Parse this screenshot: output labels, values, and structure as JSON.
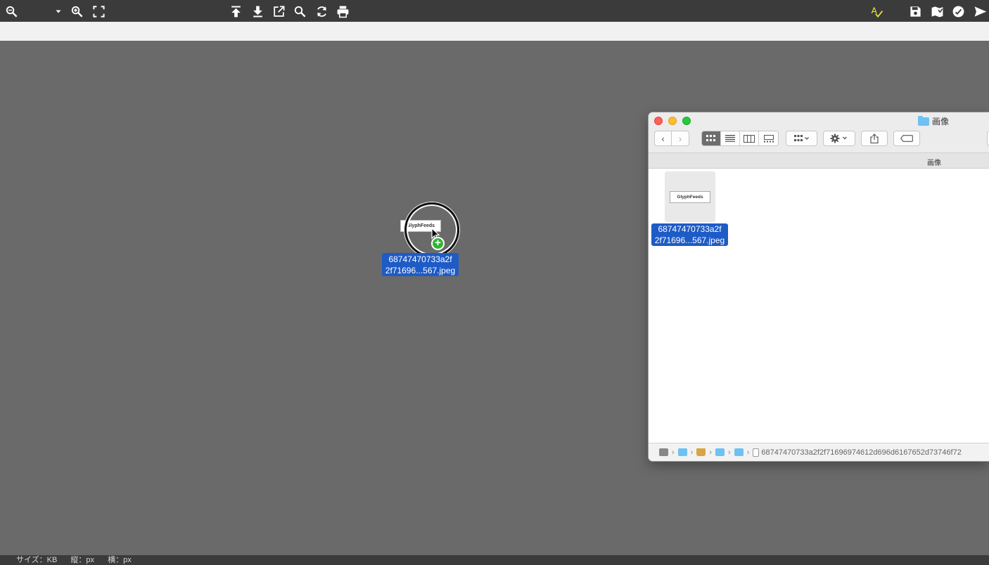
{
  "toolbar": {
    "left_icons": [
      "zoom-out-icon",
      "dropdown-arrow-icon",
      "zoom-in-icon",
      "fullscreen-icon"
    ],
    "center_icons": [
      "upload-icon",
      "download-icon",
      "open-external-icon",
      "search-icon",
      "refresh-icon",
      "print-icon"
    ],
    "right_icons": [
      "spellcheck-icon",
      "save-icon",
      "map-icon",
      "check-circle-icon",
      "send-icon"
    ],
    "spellcheck_label": "A"
  },
  "drag": {
    "thumb_text": "GlyphFeeds",
    "label_line1": "68747470733a2f",
    "label_line2": "2f71696...567.jpeg",
    "plus": "+"
  },
  "finder": {
    "title": "画像",
    "path_header": "画像",
    "back": "‹",
    "forward": "›",
    "file": {
      "thumb_text": "GlyphFeeds",
      "label_line1": "68747470733a2f",
      "label_line2": "2f71696...567.jpeg"
    },
    "pathbar_file": "68747470733a2f2f71696974612d696d6167652d73746f72"
  },
  "status": {
    "size": "サイズ：KB",
    "height": "縦：px",
    "width": "横：px"
  },
  "colors": {
    "toolbar_bg": "#3b3b3b",
    "canvas_bg": "#6a6a6a",
    "selection": "#1e5bc6",
    "spellcheck": "#f0e43a"
  }
}
